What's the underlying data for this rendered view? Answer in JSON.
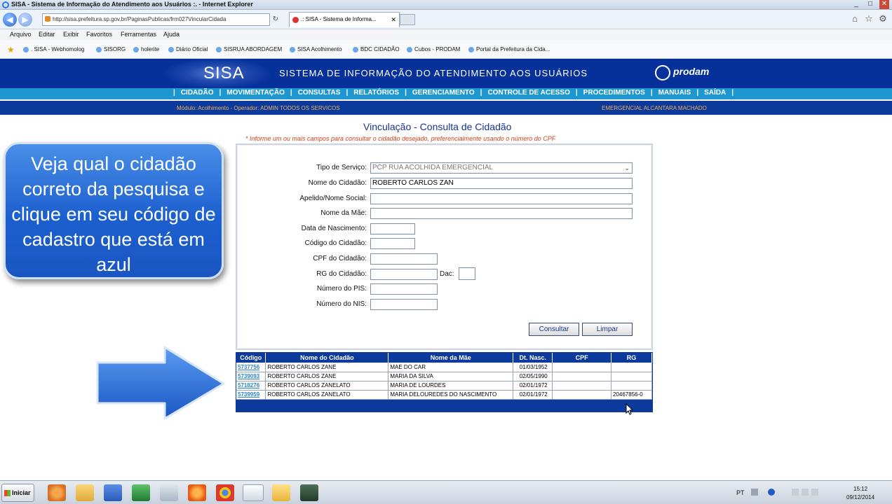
{
  "window": {
    "title": "SISA - Sistema de Informação do Atendimento aos Usuários :. - Internet Explorer",
    "address": "http://sisa.prefeitura.sp.gov.br/PaginasPublicas/frm027VincularCidada",
    "tab_title": ".: SISA - Sistema de Informa...",
    "controls": [
      "_",
      "□",
      "✕"
    ]
  },
  "menu": [
    "Arquivo",
    "Editar",
    "Exibir",
    "Favoritos",
    "Ferramentas",
    "Ajuda"
  ],
  "favorites": [
    ". SISA - Webhomolog",
    "SISORG",
    "holerite",
    "Diário Oficial",
    "SISRUA ABORDAGEM",
    "SISA Acolhimento",
    "BDC CIDADÃO",
    "Cubos - PRODAM",
    "Portal da Prefeitura da Cida..."
  ],
  "header": {
    "logo": "SISA",
    "system_name": "SISTEMA DE INFORMAÇÃO DO ATENDIMENTO AOS USUÁRIOS",
    "brand": "prodam"
  },
  "nav": [
    "CIDADÃO",
    "MOVIMENTAÇÃO",
    "CONSULTAS",
    "RELATÓRIOS",
    "GERENCIAMENTO",
    "CONTROLE DE ACESSO",
    "PROCEDIMENTOS",
    "MANUAIS",
    "SAÍDA"
  ],
  "info": {
    "module": "Módulo: Acolhimento - Operador: ADMIN TODOS OS SERVICOS",
    "unit": "EMERGENCIAL ALCANTARA MACHADO"
  },
  "page": {
    "title": "Vinculação - Consulta de Cidadão",
    "instruction": "* Informe um ou mais campos para consultar o cidadão desejado, preferencialmente usando o número do CPF"
  },
  "form": {
    "tipo_servico_label": "Tipo de Serviço:",
    "tipo_servico_value": "PCP RUA ACOLHIDA EMERGENCIAL",
    "nome_label": "Nome do Cidadão:",
    "nome_value": "ROBERTO CARLOS ZAN",
    "apelido_label": "Apelido/Nome Social:",
    "mae_label": "Nome da Mãe:",
    "nascimento_label": "Data de Nascimento:",
    "codigo_label": "Código do Cidadão:",
    "cpf_label": "CPF do Cidadão:",
    "rg_label": "RG do Cidadão:",
    "dac_label": "Dac:",
    "pis_label": "Número do PIS:",
    "nis_label": "Número do NIS:",
    "consultar": "Consultar",
    "limpar": "Limpar"
  },
  "results": {
    "headers": [
      "Código",
      "Nome do Cidadão",
      "Nome da Mãe",
      "Dt. Nasc.",
      "CPF",
      "RG"
    ],
    "rows": [
      [
        "5737756",
        "ROBERTO CARLOS ZANE",
        "MAE DO CAR",
        "01/03/1952",
        "",
        ""
      ],
      [
        "5739093",
        "ROBERTO CARLOS ZANE",
        "MARIA DA SILVA",
        "02/05/1990",
        "",
        ""
      ],
      [
        "5718276",
        "ROBERTO CARLOS ZANELATO",
        "MARIA DE LOURDES",
        "02/01/1972",
        "",
        ""
      ],
      [
        "5739959",
        "ROBERTO CARLOS ZANELATO",
        "MARIA DELOUREDES DO NASCIMENTO",
        "02/01/1972",
        "",
        "20467856-0"
      ]
    ]
  },
  "callout": {
    "text": "Veja qual o cidadão correto da pesquisa e clique em seu código de cadastro que está em azul"
  },
  "taskbar": {
    "start": "Iniciar",
    "lang": "PT",
    "time": "15:12",
    "date": "09/12/2014"
  }
}
